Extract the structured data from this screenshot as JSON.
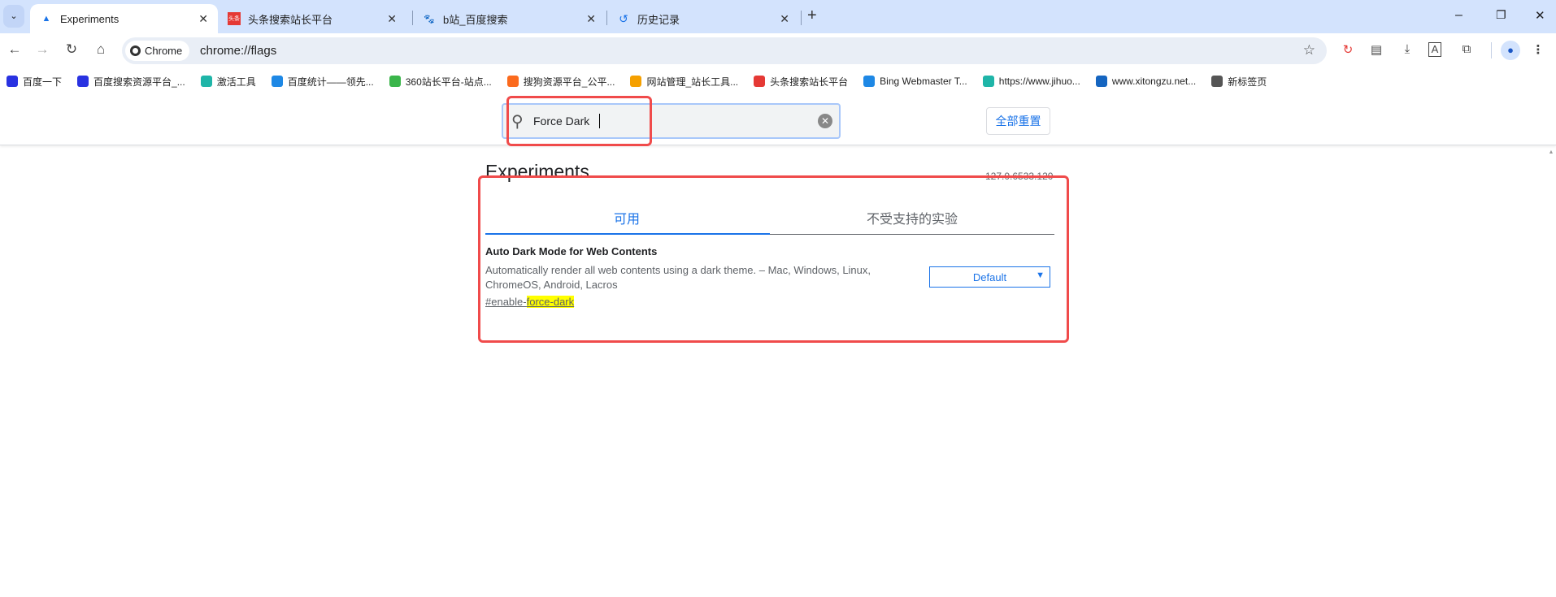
{
  "tabs": [
    {
      "title": "Experiments",
      "icon": "flask-icon",
      "active": true
    },
    {
      "title": "头条搜索站长平台",
      "icon": "toutiao-icon"
    },
    {
      "title": "b站_百度搜索",
      "icon": "baidu-paw-icon"
    },
    {
      "title": "历史记录",
      "icon": "history-icon"
    }
  ],
  "omnibox": {
    "chip": "Chrome",
    "url": "chrome://flags"
  },
  "bookmarks": [
    {
      "label": "百度一下",
      "color": "#2932e1"
    },
    {
      "label": "百度搜索资源平台_...",
      "color": "#2932e1"
    },
    {
      "label": "激活工具",
      "color": "#1fb5a8"
    },
    {
      "label": "百度统计——领先...",
      "color": "#1e88e5"
    },
    {
      "label": "360站长平台-站点...",
      "color": "#3ab54a"
    },
    {
      "label": "搜狗资源平台_公平...",
      "color": "#fb6a1d"
    },
    {
      "label": "网站管理_站长工具...",
      "color": "#f5a000"
    },
    {
      "label": "头条搜索站长平台",
      "color": "#e53935"
    },
    {
      "label": "Bing Webmaster T...",
      "color": "#1e88e5"
    },
    {
      "label": "https://www.jihuo...",
      "color": "#1fb5a8"
    },
    {
      "label": "www.xitongzu.net...",
      "color": "#1565c0"
    },
    {
      "label": "新标签页",
      "color": "#555555"
    }
  ],
  "search": {
    "value": "Force Dark"
  },
  "reset_label": "全部重置",
  "page": {
    "title": "Experiments",
    "version": "127.0.6533.120"
  },
  "page_tabs": [
    "可用",
    "不受支持的实验"
  ],
  "flag": {
    "title": "Auto Dark Mode for Web Contents",
    "description": "Automatically render all web contents using a dark theme. – Mac, Windows, Linux, ChromeOS, Android, Lacros",
    "link_prefix": "#enable-",
    "link_match": "force-dark",
    "select_value": "Default"
  },
  "colors": {
    "accent": "#1a73e8",
    "highlight_box": "#f04b4b",
    "match_highlight": "#ffff00"
  }
}
